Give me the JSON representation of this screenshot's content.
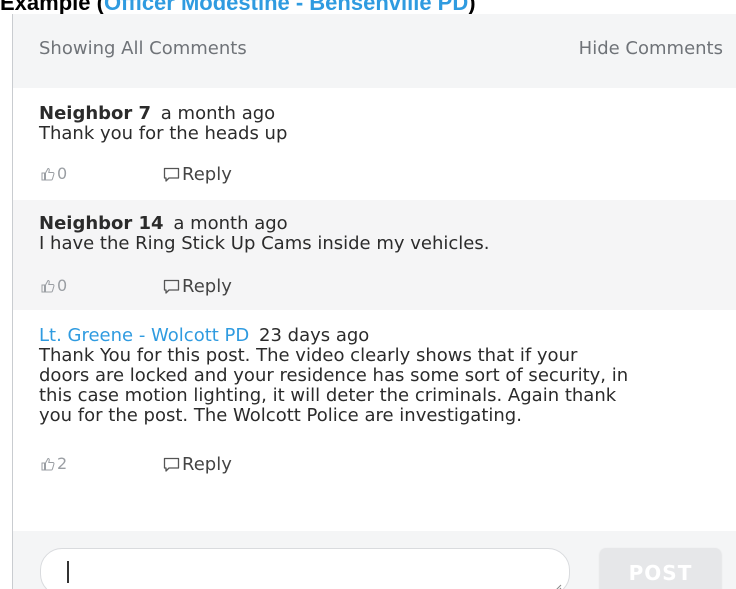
{
  "caption": {
    "prefix": "Example (",
    "link": "Officer Modestine - Bensenville PD",
    "suffix": ")"
  },
  "header": {
    "showing_label": "Showing All Comments",
    "hide_label": "Hide Comments"
  },
  "comments": [
    {
      "author": "Neighbor 7",
      "time": "a month ago",
      "body": "Thank you for the heads up",
      "likes": "0",
      "reply_label": "Reply"
    },
    {
      "author": "Neighbor 14",
      "time": "a month ago",
      "body": "I have the Ring Stick Up Cams inside my vehicles.",
      "likes": "0",
      "reply_label": "Reply"
    },
    {
      "author": "Lt. Greene - Wolcott PD",
      "time": "23 days ago",
      "body_lines": [
        "Thank You for this post. The video clearly shows that if your",
        "doors are locked and your residence has some sort of security, in",
        "this case motion lighting, it will deter the criminals. Again thank",
        "you for the post. The Wolcott Police are investigating."
      ],
      "likes": "2",
      "reply_label": "Reply"
    }
  ],
  "composer": {
    "input_value": "",
    "post_label": "POST"
  },
  "colors": {
    "official_author": "#2f9be0",
    "caption_link": "#2f9be0",
    "post_button_bg": "#e6e7e9"
  },
  "icons": {
    "like": "thumbs-up-icon",
    "reply": "speech-bubble-icon",
    "resize": "resize-grip-icon"
  }
}
